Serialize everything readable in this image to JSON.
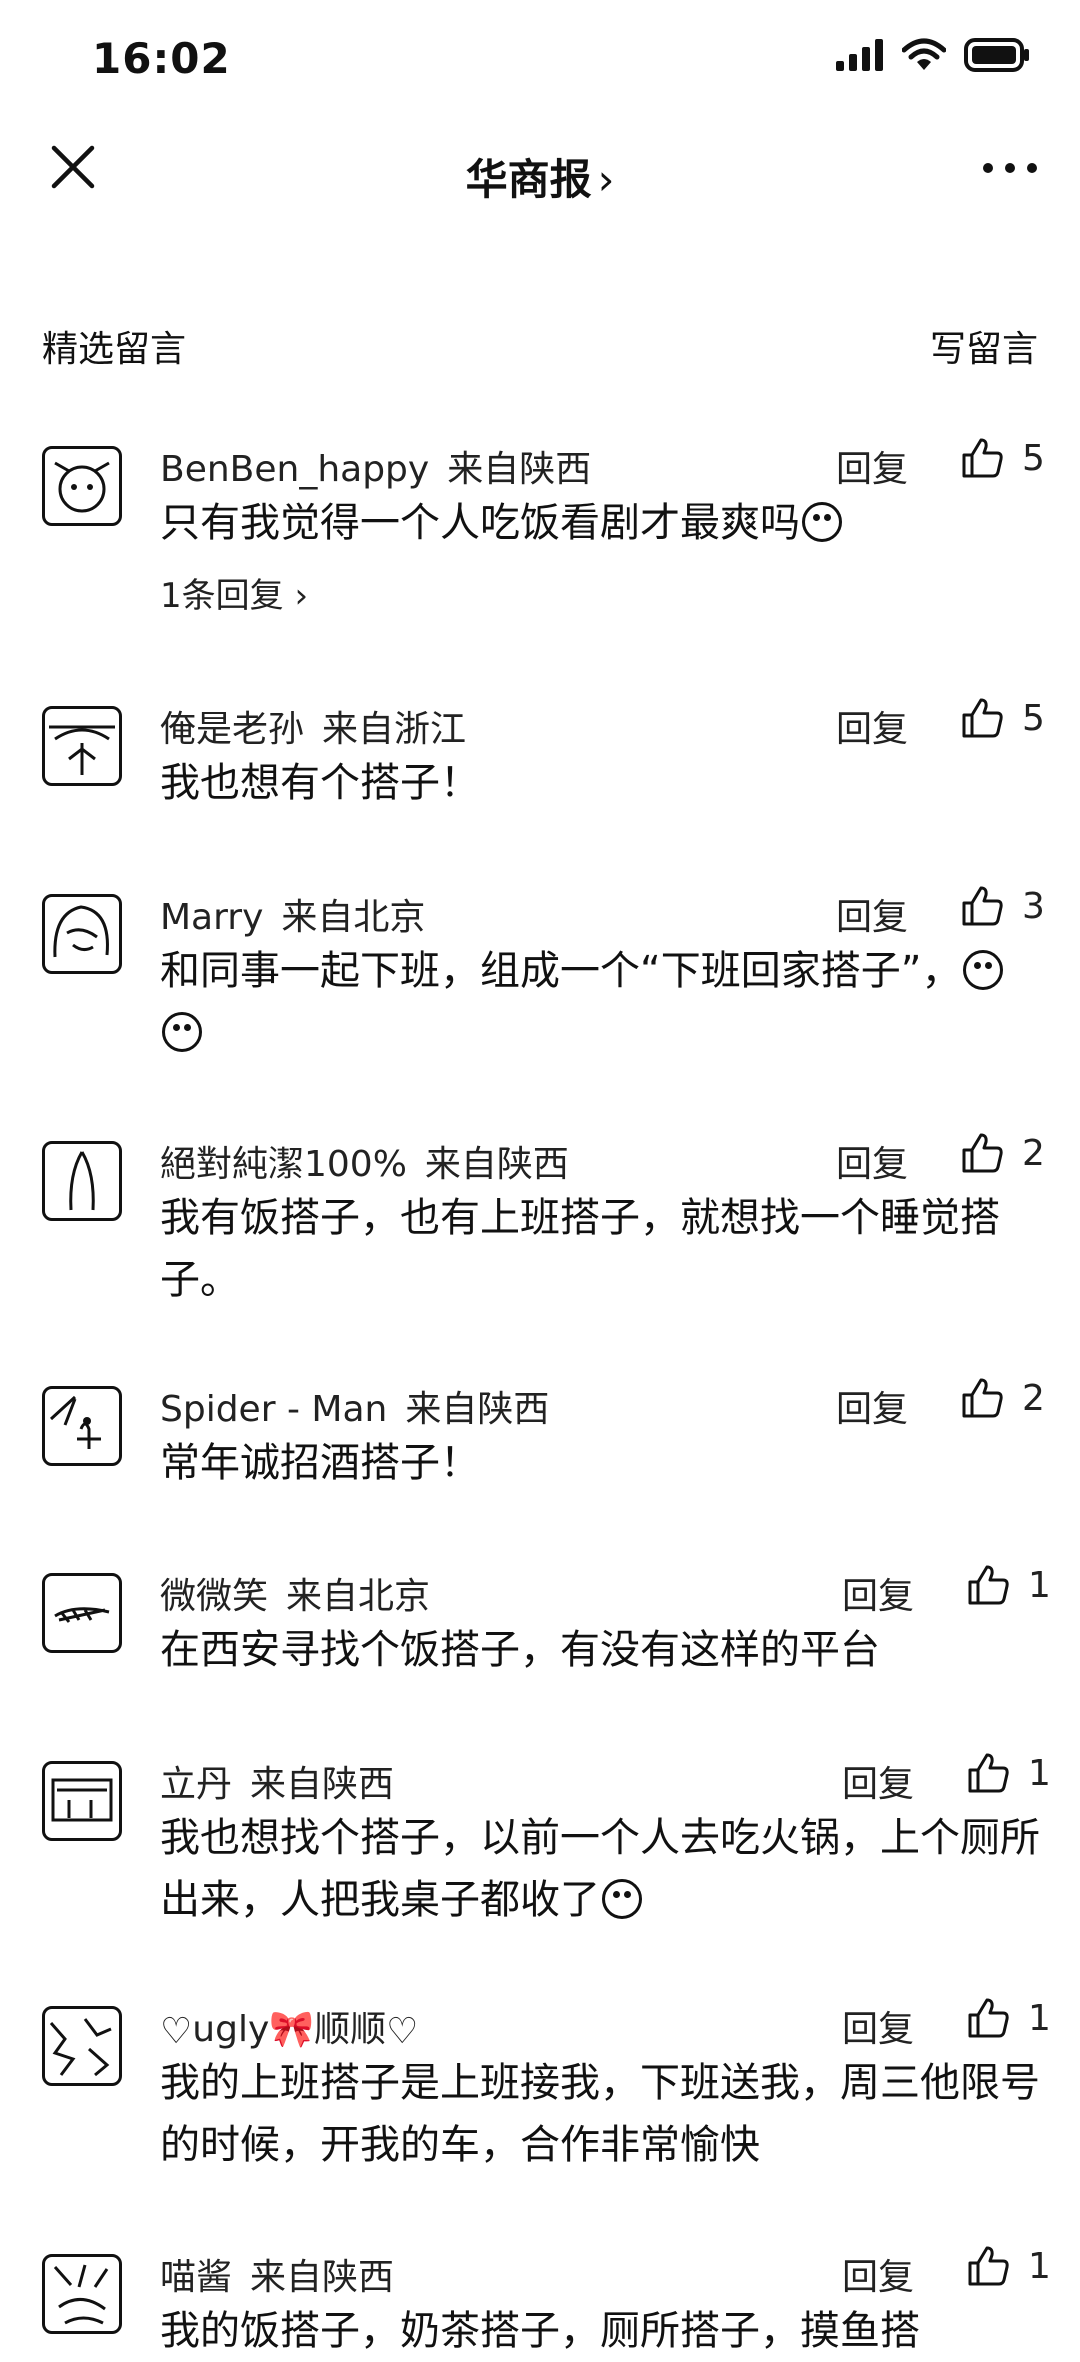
{
  "status": {
    "time": "16:02"
  },
  "nav": {
    "title": "华商报",
    "chevron": "›"
  },
  "section": {
    "title": "精选留言",
    "write": "写留言"
  },
  "reply_label": "回复",
  "comments": [
    {
      "user": "BenBen_happy",
      "location": "来自陕西",
      "likes": "5",
      "text": "只有我觉得一个人吃饭看剧才最爽吗",
      "emoji_count": 1,
      "sub_reply": "1条回复 ›"
    },
    {
      "user": "俺是老孙",
      "location": "来自浙江",
      "likes": "5",
      "text": "我也想有个搭子！"
    },
    {
      "user": "Marry",
      "location": "来自北京",
      "likes": "3",
      "text": "和同事一起下班，组成一个“下班回家搭子”，",
      "emoji_count": 2
    },
    {
      "user": "絕對純潔100%",
      "location": "来自陕西",
      "likes": "2",
      "text": "我有饭搭子，也有上班搭子，就想找一个睡觉搭子。"
    },
    {
      "user": "Spider - Man",
      "location": "来自陕西",
      "likes": "2",
      "text": "常年诚招酒搭子！"
    },
    {
      "user": "微微笑",
      "location": "来自北京",
      "likes": "1",
      "text": "在西安寻找个饭搭子，有没有这样的平台"
    },
    {
      "user": "立丹",
      "location": "来自陕西",
      "likes": "1",
      "text": "我也想找个搭子，以前一个人去吃火锅，上个厕所出来，人把我桌子都收了",
      "emoji_count": 1
    },
    {
      "user": "ugly",
      "user_suffix": "顺顺",
      "location": "",
      "likes": "1",
      "text": "我的上班搭子是上班接我，下班送我，周三他限号的时候，开我的车，合作非常愉快"
    },
    {
      "user": "喵酱",
      "location": "来自陕西",
      "likes": "1",
      "text": "我的饭搭子，奶茶搭子，厕所搭子，摸鱼搭"
    }
  ]
}
